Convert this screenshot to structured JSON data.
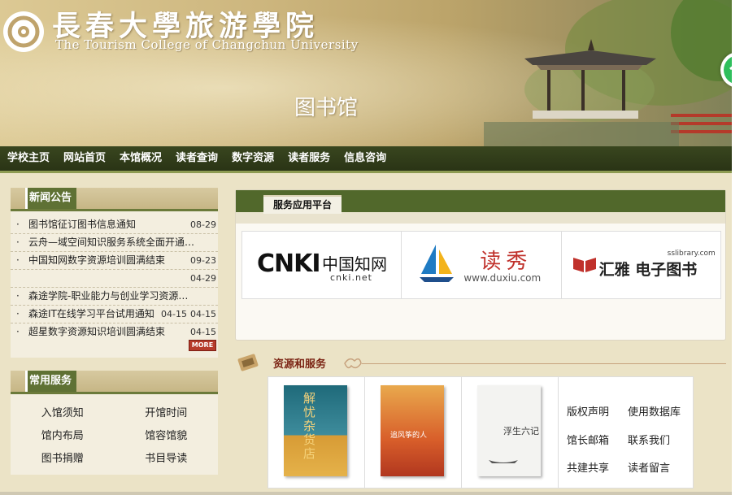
{
  "header": {
    "college_name_cn": "長春大學旅游學院",
    "college_name_en": "The Tourism College of Changchun University",
    "site_title": "图书馆"
  },
  "nav": [
    "学校主页",
    "网站首页",
    "本馆概况",
    "读者查询",
    "数字资源",
    "读者服务",
    "信息咨询"
  ],
  "news": {
    "title": "新闻公告",
    "items": [
      {
        "title": "图书馆征订图书信息通知",
        "date": "08-29"
      },
      {
        "title": "云舟—域空间知识服务系统全面开通试...",
        "date": ""
      },
      {
        "title": "中国知网数字资源培训圆满结束",
        "date": "09-23"
      },
      {
        "title": "",
        "date": "04-29"
      },
      {
        "title": "森途学院-职业能力与创业学习资源总...",
        "date": ""
      },
      {
        "title": "森途IT在线学习平台试用通知",
        "date": "04-15",
        "date2": "04-15"
      },
      {
        "title": "超星数字资源知识培训圆满结束",
        "date": "04-15"
      }
    ],
    "more_label": "MORE"
  },
  "services": {
    "title": "常用服务",
    "items": [
      "入馆须知",
      "开馆时间",
      "馆内布局",
      "馆容馆貌",
      "图书捐赠",
      "书目导读"
    ]
  },
  "platform": {
    "title": "服务应用平台",
    "logos": {
      "cnki": {
        "main": "CNKI",
        "cn": "中国知网",
        "sub": "cnki.net"
      },
      "duxiu": {
        "cn": "读秀",
        "sub": "www.duxiu.com"
      },
      "huiya": {
        "main": "汇雅 电子图书",
        "sub": "sslibrary.com"
      }
    }
  },
  "resources": {
    "title": "资源和服务",
    "books": [
      {
        "title": "解忧杂货店",
        "color": "#2f7b8c"
      },
      {
        "title": "追风筝的人",
        "color": "#e27a2c"
      },
      {
        "title": "浮生六记",
        "color": "#f3f3f1"
      }
    ],
    "links": [
      "版权声明",
      "使用数据库",
      "馆长邮箱",
      "联系我们",
      "共建共享",
      "读者留言"
    ]
  },
  "colors": {
    "nav_bg": "#2f3a18",
    "accent_green": "#5f7134",
    "news_accent": "#7b2414"
  }
}
